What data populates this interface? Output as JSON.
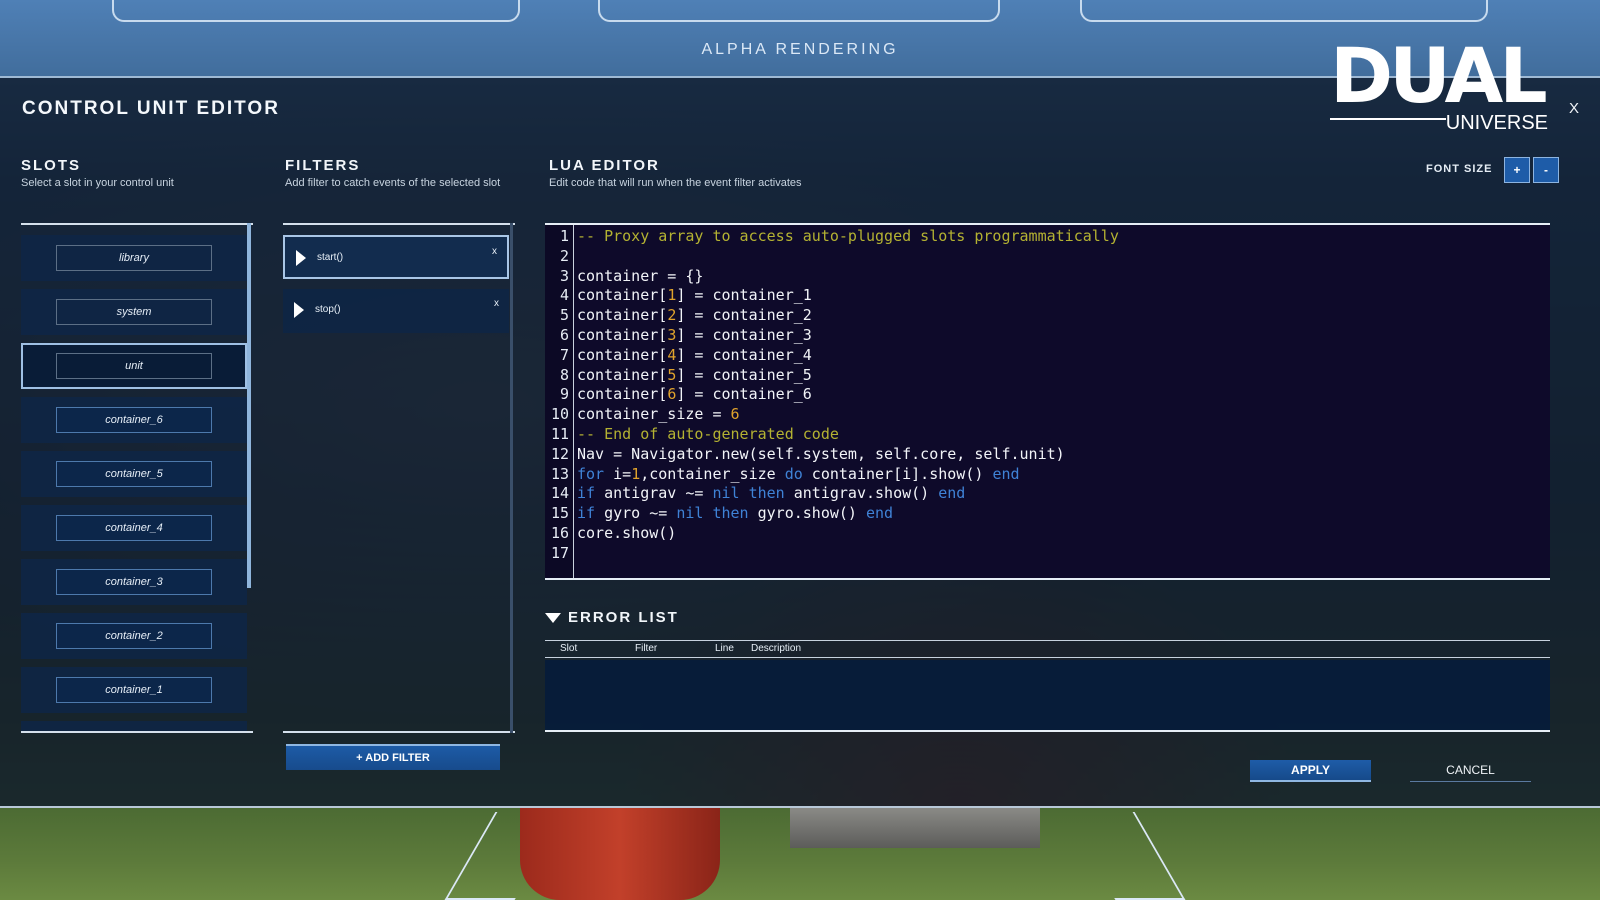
{
  "header": {
    "banner": "ALPHA RENDERING",
    "title": "CONTROL UNIT EDITOR",
    "close": "X",
    "logo_main": "DUAL",
    "logo_sub": "UNIVERSE"
  },
  "slots": {
    "heading": "SLOTS",
    "subheading": "Select a slot in your control unit",
    "selected": "unit",
    "items": [
      {
        "label": "library"
      },
      {
        "label": "system"
      },
      {
        "label": "unit"
      },
      {
        "label": "container_6"
      },
      {
        "label": "container_5"
      },
      {
        "label": "container_4"
      },
      {
        "label": "container_3"
      },
      {
        "label": "container_2"
      },
      {
        "label": "container_1"
      }
    ]
  },
  "filters": {
    "heading": "FILTERS",
    "subheading": "Add filter to catch events of the selected slot",
    "selected": "start()",
    "items": [
      {
        "label": "start()",
        "remove": "x"
      },
      {
        "label": "stop()",
        "remove": "x"
      }
    ],
    "add_label": "+ ADD FILTER"
  },
  "editor": {
    "heading": "LUA EDITOR",
    "subheading": "Edit code that will run when the event filter activates",
    "font_size_label": "FONT SIZE",
    "font_plus": "+",
    "font_minus": "-",
    "line_numbers": [
      "1",
      "2",
      "3",
      "4",
      "5",
      "6",
      "7",
      "8",
      "9",
      "10",
      "11",
      "12",
      "13",
      "14",
      "15",
      "16",
      "17"
    ],
    "code_lines": [
      "-- Proxy array to access auto-plugged slots programmatically",
      "",
      "container = {}",
      "container[1] = container_1",
      "container[2] = container_2",
      "container[3] = container_3",
      "container[4] = container_4",
      "container[5] = container_5",
      "container[6] = container_6",
      "container_size = 6",
      "-- End of auto-generated code",
      "Nav = Navigator.new(self.system, self.core, self.unit)",
      "for i=1,container_size do container[i].show() end",
      "if antigrav ~= nil then antigrav.show() end",
      "if gyro ~= nil then gyro.show() end",
      "core.show()",
      ""
    ],
    "colors": {
      "background": "#0e0a2a",
      "comment": "#b4b232",
      "number": "#e0a32c",
      "keyword": "#3f82d6",
      "text": "#f2f4f8"
    }
  },
  "errors": {
    "heading": "ERROR LIST",
    "columns": [
      "Slot",
      "Filter",
      "Line",
      "Description"
    ],
    "rows": []
  },
  "actions": {
    "apply": "APPLY",
    "cancel": "CANCEL"
  }
}
